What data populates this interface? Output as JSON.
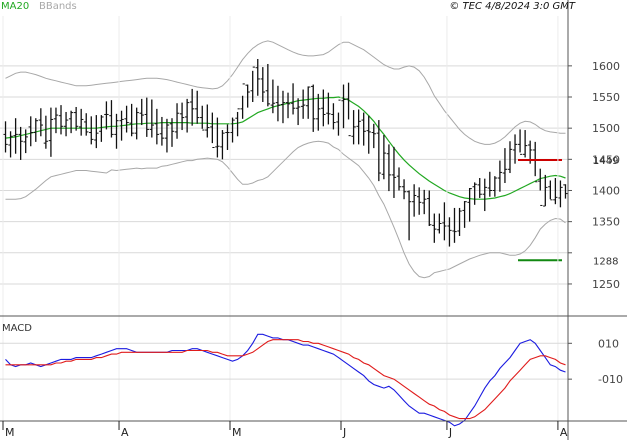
{
  "header": {
    "legend": [
      {
        "label": "MA20",
        "color": "#22a822"
      },
      {
        "label": "BBands",
        "color": "#a8a8a8"
      }
    ],
    "stamp": "© TEC 4/8/2024 3:0 GMT"
  },
  "chart_data": [
    {
      "type": "ohlc",
      "y_ticks": [
        1250,
        1300,
        1350,
        1400,
        1450,
        1500,
        1550,
        1600
      ],
      "y_tick_labels": [
        "1250",
        "",
        "1350",
        "1400",
        "1450",
        "1500",
        "1550",
        "1600"
      ],
      "ylim": [
        1205,
        1680
      ],
      "x_month_labels": [
        "M",
        "A",
        "M",
        "J",
        "J",
        "A"
      ],
      "x_month_start_index": [
        0,
        23,
        45,
        67,
        88,
        110
      ],
      "n_bars": 112,
      "grid": true,
      "levels": [
        {
          "label": "1449",
          "value": 1449,
          "color": "#cc0000"
        },
        {
          "label": "1288",
          "value": 1288,
          "color": "#118811"
        }
      ],
      "series": [
        {
          "name": "MA20",
          "color": "#22a822",
          "values": [
            1484,
            1485,
            1486,
            1488,
            1490,
            1492,
            1494,
            1496,
            1498,
            1500,
            1500,
            1500,
            1500,
            1500,
            1500,
            1500,
            1500,
            1500,
            1500,
            1501,
            1502,
            1503,
            1503,
            1504,
            1505,
            1506,
            1507,
            1507,
            1508,
            1508,
            1508,
            1509,
            1509,
            1509,
            1509,
            1509,
            1509,
            1508,
            1508,
            1508,
            1508,
            1507,
            1507,
            1507,
            1507,
            1507,
            1508,
            1510,
            1515,
            1520,
            1525,
            1528,
            1531,
            1534,
            1536,
            1538,
            1540,
            1542,
            1544,
            1545,
            1546,
            1547,
            1548,
            1548,
            1549,
            1549,
            1550,
            1548,
            1545,
            1540,
            1535,
            1528,
            1520,
            1511,
            1500,
            1490,
            1479,
            1468,
            1458,
            1449,
            1441,
            1434,
            1427,
            1421,
            1415,
            1410,
            1405,
            1400,
            1396,
            1393,
            1390,
            1388,
            1387,
            1386,
            1386,
            1386,
            1387,
            1388,
            1390,
            1392,
            1395,
            1399,
            1403,
            1407,
            1411,
            1415,
            1419,
            1421,
            1423,
            1424,
            1423,
            1420
          ]
        },
        {
          "name": "BBands upper",
          "color": "#a8a8a8",
          "values": [
            1580,
            1584,
            1588,
            1590,
            1590,
            1588,
            1586,
            1583,
            1580,
            1578,
            1576,
            1574,
            1572,
            1570,
            1568,
            1568,
            1568,
            1569,
            1570,
            1571,
            1572,
            1573,
            1574,
            1575,
            1576,
            1577,
            1578,
            1579,
            1580,
            1580,
            1580,
            1579,
            1578,
            1576,
            1574,
            1572,
            1570,
            1568,
            1566,
            1565,
            1564,
            1563,
            1564,
            1568,
            1576,
            1586,
            1598,
            1610,
            1620,
            1628,
            1634,
            1638,
            1640,
            1638,
            1634,
            1630,
            1626,
            1622,
            1619,
            1617,
            1616,
            1616,
            1617,
            1618,
            1622,
            1628,
            1634,
            1638,
            1638,
            1634,
            1630,
            1626,
            1620,
            1614,
            1608,
            1602,
            1598,
            1595,
            1595,
            1598,
            1600,
            1598,
            1592,
            1582,
            1568,
            1552,
            1540,
            1528,
            1518,
            1508,
            1498,
            1490,
            1484,
            1479,
            1476,
            1474,
            1474,
            1476,
            1480,
            1486,
            1494,
            1502,
            1508,
            1511,
            1510,
            1506,
            1500,
            1496,
            1494,
            1493,
            1492,
            1492
          ]
        },
        {
          "name": "BBands lower",
          "color": "#a8a8a8",
          "values": [
            1386,
            1386,
            1386,
            1387,
            1390,
            1396,
            1402,
            1409,
            1416,
            1422,
            1424,
            1426,
            1428,
            1430,
            1432,
            1432,
            1432,
            1431,
            1430,
            1429,
            1428,
            1433,
            1432,
            1433,
            1434,
            1435,
            1436,
            1435,
            1436,
            1436,
            1436,
            1439,
            1440,
            1442,
            1444,
            1446,
            1448,
            1448,
            1450,
            1451,
            1452,
            1451,
            1450,
            1446,
            1438,
            1428,
            1418,
            1410,
            1410,
            1412,
            1416,
            1418,
            1422,
            1430,
            1438,
            1446,
            1454,
            1462,
            1469,
            1473,
            1476,
            1478,
            1479,
            1478,
            1476,
            1470,
            1466,
            1458,
            1452,
            1446,
            1440,
            1430,
            1420,
            1408,
            1392,
            1378,
            1360,
            1341,
            1321,
            1300,
            1282,
            1270,
            1262,
            1260,
            1262,
            1268,
            1270,
            1272,
            1274,
            1278,
            1282,
            1286,
            1290,
            1293,
            1296,
            1298,
            1300,
            1300,
            1300,
            1298,
            1296,
            1296,
            1298,
            1303,
            1312,
            1324,
            1338,
            1346,
            1352,
            1355,
            1354,
            1348
          ]
        }
      ],
      "bars": {
        "open": [
          1490,
          1473,
          1488,
          1490,
          1478,
          1502,
          1493,
          1513,
          1476,
          1480,
          1515,
          1520,
          1503,
          1515,
          1525,
          1502,
          1510,
          1493,
          1481,
          1495,
          1522,
          1520,
          1490,
          1512,
          1515,
          1508,
          1492,
          1524,
          1522,
          1498,
          1507,
          1491,
          1484,
          1507,
          1494,
          1523,
          1518,
          1542,
          1531,
          1517,
          1497,
          1502,
          1470,
          1470,
          1493,
          1493,
          1516,
          1531,
          1569,
          1560,
          1597,
          1579,
          1560,
          1537,
          1541,
          1538,
          1541,
          1540,
          1532,
          1535,
          1536,
          1567,
          1515,
          1532,
          1524,
          1522,
          1510,
          1544,
          1547,
          1487,
          1503,
          1513,
          1496,
          1493,
          1492,
          1426,
          1459,
          1425,
          1423,
          1406,
          1398,
          1382,
          1390,
          1380,
          1387,
          1344,
          1337,
          1348,
          1343,
          1335,
          1335,
          1368,
          1381,
          1406,
          1409,
          1394,
          1404,
          1400,
          1420,
          1428,
          1434,
          1465,
          1474,
          1458,
          1473,
          1465,
          1415,
          1375,
          1406,
          1385,
          1388,
          1409
        ],
        "high": [
          1511,
          1495,
          1516,
          1502,
          1498,
          1519,
          1516,
          1532,
          1520,
          1533,
          1533,
          1537,
          1526,
          1528,
          1534,
          1531,
          1524,
          1519,
          1521,
          1521,
          1543,
          1545,
          1523,
          1528,
          1536,
          1539,
          1533,
          1547,
          1549,
          1546,
          1531,
          1518,
          1515,
          1516,
          1540,
          1541,
          1547,
          1563,
          1560,
          1536,
          1538,
          1525,
          1517,
          1497,
          1506,
          1517,
          1526,
          1552,
          1570,
          1592,
          1611,
          1598,
          1603,
          1578,
          1568,
          1560,
          1557,
          1572,
          1548,
          1562,
          1567,
          1570,
          1555,
          1562,
          1557,
          1540,
          1525,
          1570,
          1573,
          1529,
          1530,
          1525,
          1520,
          1507,
          1513,
          1489,
          1474,
          1470,
          1437,
          1418,
          1400,
          1410,
          1405,
          1401,
          1400,
          1363,
          1363,
          1381,
          1357,
          1372,
          1372,
          1383,
          1404,
          1413,
          1420,
          1419,
          1430,
          1423,
          1448,
          1468,
          1479,
          1490,
          1498,
          1497,
          1480,
          1478,
          1435,
          1425,
          1416,
          1420,
          1416,
          1410
        ],
        "low": [
          1461,
          1453,
          1459,
          1449,
          1460,
          1471,
          1478,
          1487,
          1467,
          1454,
          1492,
          1490,
          1487,
          1492,
          1496,
          1488,
          1488,
          1474,
          1468,
          1478,
          1498,
          1485,
          1467,
          1480,
          1493,
          1487,
          1482,
          1505,
          1486,
          1485,
          1474,
          1472,
          1461,
          1470,
          1483,
          1497,
          1493,
          1504,
          1507,
          1499,
          1485,
          1476,
          1453,
          1450,
          1465,
          1477,
          1487,
          1515,
          1533,
          1542,
          1552,
          1542,
          1535,
          1524,
          1511,
          1508,
          1516,
          1522,
          1505,
          1515,
          1515,
          1494,
          1496,
          1503,
          1506,
          1498,
          1488,
          1500,
          1514,
          1474,
          1474,
          1472,
          1459,
          1468,
          1415,
          1418,
          1399,
          1388,
          1400,
          1386,
          1320,
          1358,
          1361,
          1362,
          1343,
          1316,
          1331,
          1320,
          1310,
          1316,
          1327,
          1340,
          1350,
          1377,
          1388,
          1367,
          1390,
          1390,
          1398,
          1412,
          1428,
          1443,
          1461,
          1453,
          1443,
          1423,
          1400,
          1375,
          1386,
          1378,
          1373,
          1387
        ],
        "close": [
          1474,
          1487,
          1490,
          1479,
          1486,
          1493,
          1512,
          1505,
          1479,
          1514,
          1521,
          1503,
          1513,
          1525,
          1503,
          1514,
          1494,
          1482,
          1492,
          1518,
          1522,
          1490,
          1512,
          1514,
          1509,
          1492,
          1525,
          1521,
          1498,
          1505,
          1490,
          1484,
          1505,
          1495,
          1524,
          1517,
          1541,
          1531,
          1517,
          1497,
          1501,
          1469,
          1471,
          1492,
          1493,
          1513,
          1531,
          1571,
          1558,
          1598,
          1579,
          1558,
          1539,
          1540,
          1537,
          1541,
          1539,
          1532,
          1534,
          1537,
          1566,
          1515,
          1531,
          1522,
          1523,
          1509,
          1545,
          1546,
          1488,
          1502,
          1511,
          1495,
          1494,
          1491,
          1428,
          1460,
          1425,
          1421,
          1406,
          1398,
          1382,
          1392,
          1381,
          1386,
          1345,
          1338,
          1347,
          1343,
          1336,
          1334,
          1367,
          1382,
          1403,
          1410,
          1394,
          1405,
          1400,
          1420,
          1429,
          1434,
          1466,
          1474,
          1458,
          1472,
          1465,
          1414,
          1376,
          1405,
          1385,
          1389,
          1405,
          1395
        ]
      }
    },
    {
      "type": "line",
      "title": "MACD",
      "y_ticks": [
        10,
        -10
      ],
      "y_tick_labels": [
        "010",
        "-010"
      ],
      "ylim": [
        -30,
        23
      ],
      "grid": true,
      "series": [
        {
          "name": "MACD",
          "color": "#1c1ce0",
          "values": [
            1,
            -2,
            -3,
            -2,
            -2,
            -1,
            -2,
            -3,
            -2,
            -1,
            0,
            1,
            1,
            1,
            2,
            2,
            2,
            2,
            3,
            4,
            5,
            6,
            7,
            7,
            7,
            6,
            5,
            5,
            5,
            5,
            5,
            5,
            5,
            6,
            6,
            6,
            6,
            7,
            7,
            6,
            5,
            4,
            3,
            2,
            1,
            0,
            1,
            3,
            6,
            10,
            15,
            15,
            14,
            13,
            13,
            12,
            12,
            11,
            10,
            9,
            9,
            8,
            7,
            6,
            5,
            4,
            2,
            0,
            -2,
            -4,
            -6,
            -8,
            -11,
            -13,
            -14,
            -15,
            -14,
            -16,
            -19,
            -22,
            -25,
            -27,
            -29,
            -29,
            -30,
            -31,
            -32,
            -33,
            -34,
            -36,
            -35,
            -33,
            -29,
            -25,
            -20,
            -15,
            -11,
            -8,
            -4,
            -1,
            2,
            6,
            10,
            11,
            12,
            10,
            6,
            2,
            -2,
            -3,
            -5,
            -6
          ]
        },
        {
          "name": "Signal",
          "color": "#e01c1c",
          "values": [
            -2,
            -2,
            -2,
            -2,
            -2,
            -2,
            -2,
            -2,
            -2,
            -2,
            -1,
            -1,
            0,
            0,
            1,
            1,
            1,
            1,
            2,
            2,
            3,
            4,
            4,
            5,
            5,
            5,
            5,
            5,
            5,
            5,
            5,
            5,
            5,
            5,
            5,
            5,
            6,
            6,
            6,
            6,
            6,
            5,
            5,
            4,
            3,
            3,
            3,
            3,
            4,
            5,
            7,
            9,
            11,
            12,
            12,
            12,
            12,
            12,
            12,
            11,
            11,
            10,
            10,
            9,
            8,
            7,
            6,
            5,
            4,
            2,
            1,
            -1,
            -2,
            -4,
            -6,
            -8,
            -9,
            -10,
            -12,
            -14,
            -16,
            -18,
            -20,
            -22,
            -24,
            -25,
            -27,
            -28,
            -30,
            -31,
            -32,
            -32,
            -32,
            -31,
            -29,
            -27,
            -24,
            -21,
            -18,
            -15,
            -11,
            -8,
            -5,
            -2,
            1,
            2,
            3,
            3,
            2,
            1,
            -1,
            -2
          ]
        }
      ]
    }
  ]
}
